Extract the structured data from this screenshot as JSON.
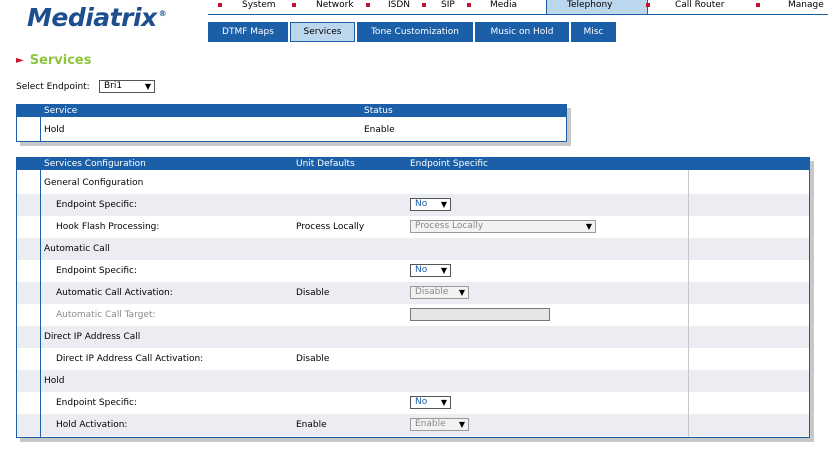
{
  "logo": {
    "text": "Mediatrix",
    "mark": "®"
  },
  "top_nav": {
    "items": [
      "System",
      "Network",
      "ISDN",
      "SIP",
      "Media",
      "Telephony",
      "Call Router",
      "Manage"
    ],
    "active": "Telephony"
  },
  "sub_nav": {
    "items": [
      "DTMF Maps",
      "Services",
      "Tone Customization",
      "Music on Hold",
      "Misc"
    ],
    "active": "Services"
  },
  "page": {
    "title": "Services"
  },
  "endpoint": {
    "label": "Select Endpoint:",
    "value": "Bri1"
  },
  "services_table": {
    "headers": {
      "service": "Service",
      "status": "Status"
    },
    "rows": [
      {
        "service": "Hold",
        "status": "Enable"
      }
    ]
  },
  "config_table": {
    "headers": {
      "config": "Services Configuration",
      "unit_defaults": "Unit Defaults",
      "endpoint_specific": "Endpoint Specific"
    },
    "rows": [
      {
        "label": "General Configuration",
        "unit": "",
        "control": ""
      },
      {
        "label": "Endpoint Specific:",
        "unit": "",
        "control": "No"
      },
      {
        "label": "Hook Flash Processing:",
        "unit": "Process Locally",
        "control": "Process Locally"
      },
      {
        "label": "Automatic Call",
        "unit": "",
        "control": ""
      },
      {
        "label": "Endpoint Specific:",
        "unit": "",
        "control": "No"
      },
      {
        "label": "Automatic Call Activation:",
        "unit": "Disable",
        "control": "Disable"
      },
      {
        "label": "Automatic Call Target:",
        "unit": "",
        "control": ""
      },
      {
        "label": "Direct IP Address Call",
        "unit": "",
        "control": ""
      },
      {
        "label": "Direct IP Address Call Activation:",
        "unit": "Disable",
        "control": ""
      },
      {
        "label": "Hold",
        "unit": "",
        "control": ""
      },
      {
        "label": "Endpoint Specific:",
        "unit": "",
        "control": "No"
      },
      {
        "label": "Hold Activation:",
        "unit": "Enable",
        "control": "Enable"
      }
    ]
  },
  "colors": {
    "brand_blue": "#1a5fa8",
    "title_green": "#8cc63f",
    "bullet_red": "#c8102e",
    "active_tab": "#bcd6ee",
    "row_alt": "#ecedf2"
  }
}
